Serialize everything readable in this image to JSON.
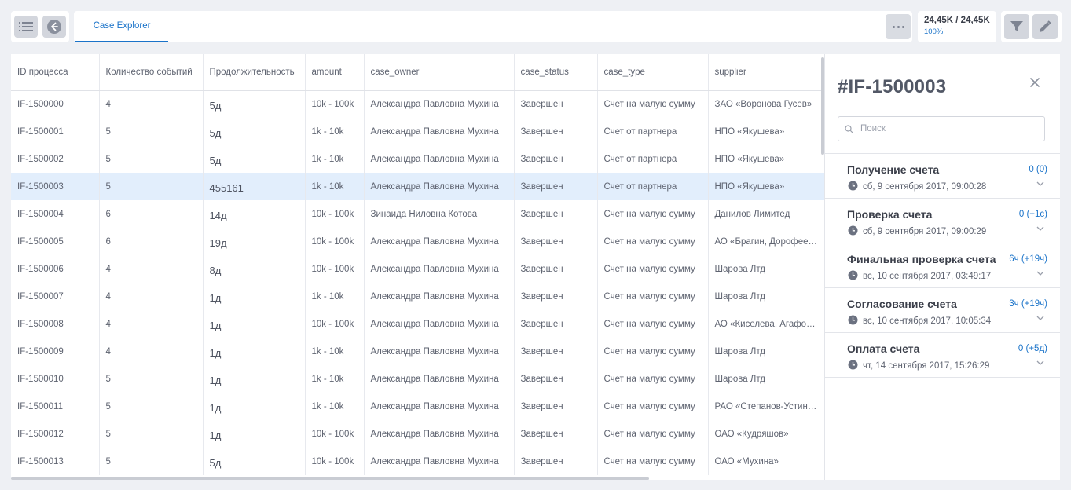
{
  "toolbar": {
    "tab_label": "Case Explorer",
    "count_main": "24,45K / 24,45K",
    "count_pct": "100%"
  },
  "table": {
    "columns": [
      "ID процесса",
      "Количество событий",
      "Продолжительность",
      "amount",
      "case_owner",
      "case_status",
      "case_type",
      "supplier"
    ],
    "rows": [
      [
        "IF-1500000",
        "4",
        "5д",
        "10k - 100k",
        "Александра Павловна Мухина",
        "Завершен",
        "Счет на малую сумму",
        "ЗАО «Воронова Гусев»"
      ],
      [
        "IF-1500001",
        "5",
        "5д",
        "1k - 10k",
        "Александра Павловна Мухина",
        "Завершен",
        "Счет от партнера",
        "НПО «Якушева»"
      ],
      [
        "IF-1500002",
        "5",
        "5д",
        "1k - 10k",
        "Александра Павловна Мухина",
        "Завершен",
        "Счет от партнера",
        "НПО «Якушева»"
      ],
      [
        "IF-1500003",
        "5",
        "455161",
        "1k - 10k",
        "Александра Павловна Мухина",
        "Завершен",
        "Счет от партнера",
        "НПО «Якушева»"
      ],
      [
        "IF-1500004",
        "6",
        "14д",
        "10k - 100k",
        "Зинаида Ниловна Котова",
        "Завершен",
        "Счет на малую сумму",
        "Данилов Лимитед"
      ],
      [
        "IF-1500005",
        "6",
        "19д",
        "10k - 100k",
        "Александра Павловна Мухина",
        "Завершен",
        "Счет на малую сумму",
        "АО «Брагин, Дорофеев и Ко»"
      ],
      [
        "IF-1500006",
        "4",
        "8д",
        "10k - 100k",
        "Александра Павловна Мухина",
        "Завершен",
        "Счет на малую сумму",
        "Шарова Лтд"
      ],
      [
        "IF-1500007",
        "4",
        "1д",
        "1k - 10k",
        "Александра Павловна Мухина",
        "Завершен",
        "Счет на малую сумму",
        "Шарова Лтд"
      ],
      [
        "IF-1500008",
        "4",
        "1д",
        "10k - 100k",
        "Александра Павловна Мухина",
        "Завершен",
        "Счет на малую сумму",
        "АО «Киселева, Агафонова»"
      ],
      [
        "IF-1500009",
        "4",
        "1д",
        "1k - 10k",
        "Александра Павловна Мухина",
        "Завершен",
        "Счет на малую сумму",
        "Шарова Лтд"
      ],
      [
        "IF-1500010",
        "5",
        "1д",
        "1k - 10k",
        "Александра Павловна Мухина",
        "Завершен",
        "Счет на малую сумму",
        "Шарова Лтд"
      ],
      [
        "IF-1500011",
        "5",
        "1д",
        "1k - 10k",
        "Александра Павловна Мухина",
        "Завершен",
        "Счет на малую сумму",
        "РАО «Степанов-Устинов»"
      ],
      [
        "IF-1500012",
        "5",
        "1д",
        "10k - 100k",
        "Александра Павловна Мухина",
        "Завершен",
        "Счет на малую сумму",
        "ОАО «Кудряшов»"
      ],
      [
        "IF-1500013",
        "5",
        "5д",
        "10k - 100k",
        "Александра Павловна Мухина",
        "Завершен",
        "Счет на малую сумму",
        "ОАО «Мухина»"
      ]
    ],
    "selected_row": 3
  },
  "panel": {
    "title": "#IF-1500003",
    "search_placeholder": "Поиск",
    "events": [
      {
        "name": "Получение счета",
        "duration": "0 (0)",
        "date": "сб, 9 сентября 2017, 09:00:28"
      },
      {
        "name": "Проверка счета",
        "duration": "0 (+1с)",
        "date": "сб, 9 сентября 2017, 09:00:29"
      },
      {
        "name": "Финальная проверка счета",
        "duration": "6ч (+19ч)",
        "date": "вс, 10 сентября 2017, 03:49:17"
      },
      {
        "name": "Согласование счета",
        "duration": "3ч (+19ч)",
        "date": "вс, 10 сентября 2017, 10:05:34"
      },
      {
        "name": "Оплата счета",
        "duration": "0 (+5д)",
        "date": "чт, 14 сентября 2017, 15:26:29"
      }
    ]
  },
  "colors": {
    "accent": "#1a73c9",
    "selected_row": "#e2eefc",
    "background": "#eef0f4"
  },
  "icons": [
    "menu-icon",
    "back-icon",
    "more-icon",
    "filter-icon",
    "edit-icon",
    "close-icon",
    "search-icon",
    "clock-icon",
    "chevron-down-icon"
  ]
}
